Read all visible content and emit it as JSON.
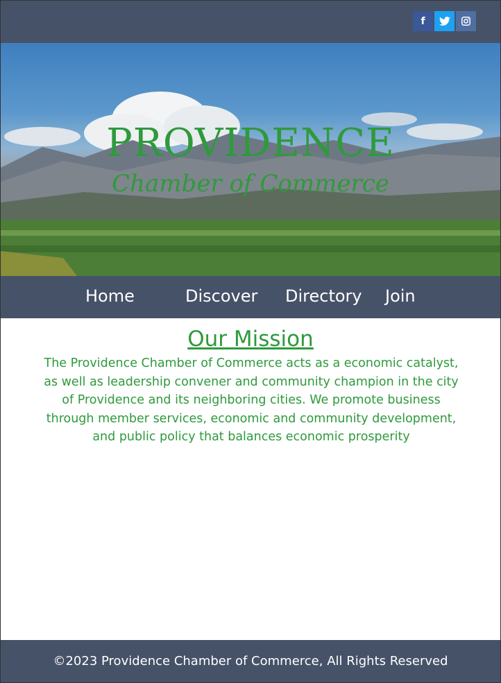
{
  "social": {
    "facebook_glyph": "f",
    "twitter_glyph": "t",
    "instagram_glyph": "◙"
  },
  "hero": {
    "title": "PROVIDENCE",
    "subtitle": "Chamber of Commerce"
  },
  "nav": {
    "items": [
      {
        "label": "Home"
      },
      {
        "label": "Discover"
      },
      {
        "label": "Directory"
      },
      {
        "label": "Join"
      }
    ]
  },
  "mission": {
    "heading": "Our Mission",
    "body": "The Providence Chamber of Commerce acts as a economic catalyst, as well as leadership convener and community champion in the city of Providence and its neighboring cities. We promote business through member services, economic and community development, and public policy that balances economic prosperity"
  },
  "footer": {
    "copyright": "©2023 Providence Chamber of Commerce, All Rights Reserved"
  }
}
